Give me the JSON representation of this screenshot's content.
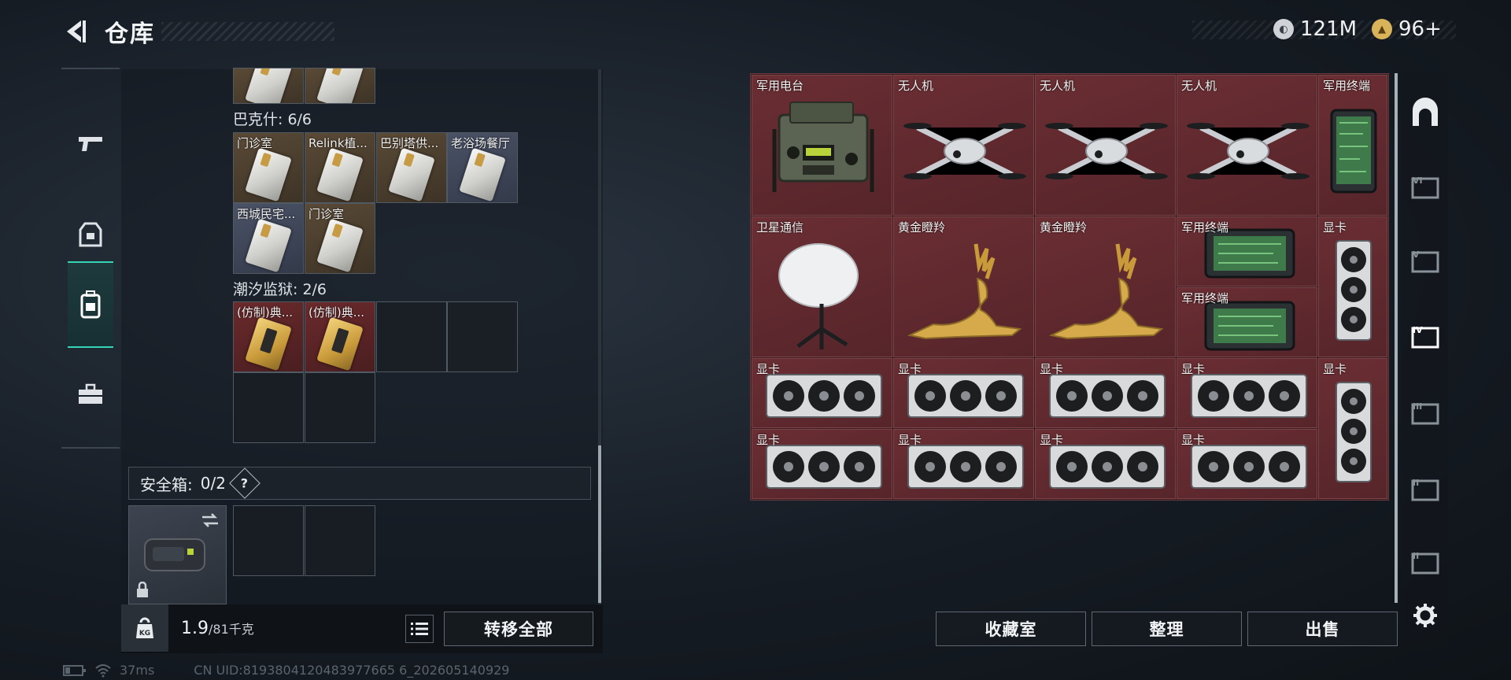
{
  "header": {
    "title": "仓库",
    "currency_silver": "121M",
    "currency_gold": "96+"
  },
  "left_nav": {
    "items": [
      {
        "name": "weapons",
        "icon": "gun-icon",
        "active": false
      },
      {
        "name": "armor",
        "icon": "vest-icon",
        "active": false
      },
      {
        "name": "backpack",
        "icon": "backpack-icon",
        "active": true
      },
      {
        "name": "toolbox",
        "icon": "briefcase-icon",
        "active": false
      }
    ]
  },
  "sections": [
    {
      "title": "巴克什: 6/6",
      "items": [
        "门诊室",
        "Relink植...",
        "巴别塔供...",
        "老浴场餐厅",
        "西城民宅...",
        "门诊室"
      ]
    },
    {
      "title": "潮汐监狱: 2/6",
      "items": [
        "(仿制)典...",
        "(仿制)典..."
      ]
    }
  ],
  "safebox": {
    "label": "安全箱:",
    "count": "0/2",
    "help": "?"
  },
  "weight": {
    "current": "1.9",
    "max": "/81千克",
    "kg_badge": "KG"
  },
  "buttons": {
    "transfer_all": "转移全部",
    "collection": "收藏室",
    "organize": "整理",
    "sell": "出售"
  },
  "grid_items": [
    {
      "label": "军用电台",
      "kind": "radio"
    },
    {
      "label": "无人机",
      "kind": "drone"
    },
    {
      "label": "无人机",
      "kind": "drone"
    },
    {
      "label": "无人机",
      "kind": "drone"
    },
    {
      "label": "军用终端",
      "kind": "terminal"
    },
    {
      "label": "卫星通信",
      "kind": "satellite"
    },
    {
      "label": "黄金瞪羚",
      "kind": "gazelle"
    },
    {
      "label": "黄金瞪羚",
      "kind": "gazelle"
    },
    {
      "label": "军用终端",
      "kind": "terminal"
    },
    {
      "label": "军用终端",
      "kind": "terminal"
    },
    {
      "label": "显卡",
      "kind": "gpu-v"
    },
    {
      "label": "显卡",
      "kind": "gpu-v"
    },
    {
      "label": "显卡",
      "kind": "gpu"
    },
    {
      "label": "显卡",
      "kind": "gpu"
    },
    {
      "label": "显卡",
      "kind": "gpu"
    },
    {
      "label": "显卡",
      "kind": "gpu"
    },
    {
      "label": "显卡",
      "kind": "gpu"
    },
    {
      "label": "显卡",
      "kind": "gpu"
    },
    {
      "label": "显卡",
      "kind": "gpu"
    },
    {
      "label": "显卡",
      "kind": "gpu"
    }
  ],
  "right_nav": {
    "tiers": [
      "VI",
      "V",
      "IV",
      "III",
      "II",
      "II",
      "II"
    ]
  },
  "status": {
    "ping": "37ms",
    "uid": "CN UID:8193804120483977665 6_202605140929"
  }
}
